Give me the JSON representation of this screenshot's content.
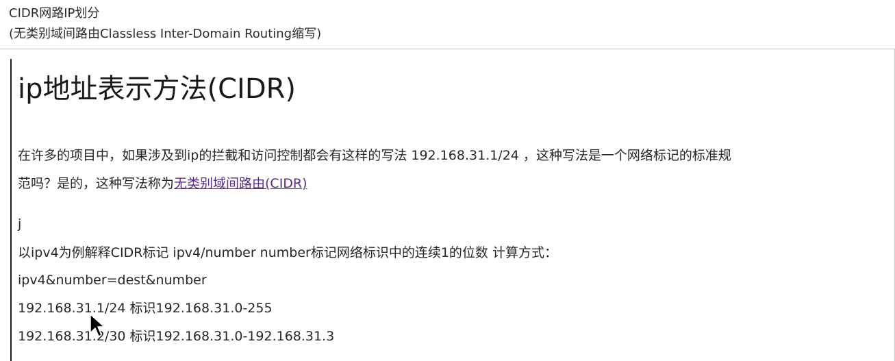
{
  "header": {
    "title_line_1": "CIDR网路IP划分",
    "title_line_2": "(无类别域间路由Classless Inter-Domain Routing缩写)"
  },
  "document": {
    "heading": "ip地址表示方法(CIDR)",
    "paragraph_1": "在许多的项目中，如果涉及到ip的拦截和访问控制都会有这样的写法 192.168.31.1/24 ，这种写法是一个网络标记的标准规",
    "paragraph_2_prefix": "范吗？是的，这种写法称为",
    "paragraph_2_link": "无类别域间路由(CIDR)",
    "line_j": "j",
    "line_explain": "以ipv4为例解释CIDR标记 ipv4/number     number标记网络标识中的连续1的位数 计算方式：",
    "line_formula": "ipv4&number=dest&number",
    "line_example_1": "192.168.31.1/24 标识192.168.31.0-255",
    "line_example_2": "192.168.31.2/30 标识192.168.31.0-192.168.31.3"
  },
  "cursor": {
    "icon": "mouse-pointer-icon"
  },
  "colors": {
    "link": "#5b2c83",
    "text": "#262626",
    "rule": "#bdbdbd"
  }
}
